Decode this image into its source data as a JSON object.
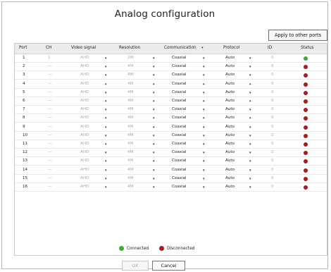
{
  "window": {
    "title": "Analog configuration",
    "apply_button": "Apply to other ports"
  },
  "table": {
    "headers": [
      "Port",
      "CH",
      "Video signal",
      "Resolution",
      "Communication",
      "Protocol",
      "ID",
      "Status"
    ],
    "rows": [
      {
        "port": "1",
        "ch": "1",
        "video": "AHD",
        "resolution": "2M",
        "communication": "Coaxial",
        "protocol": "Auto",
        "id": "0",
        "status": "connected"
      },
      {
        "port": "2",
        "ch": "—",
        "video": "AHD",
        "resolution": "4M",
        "communication": "Coaxial",
        "protocol": "Auto",
        "id": "0",
        "status": "disconnected"
      },
      {
        "port": "3",
        "ch": "—",
        "video": "AHD",
        "resolution": "4M",
        "communication": "Coaxial",
        "protocol": "Auto",
        "id": "0",
        "status": "disconnected"
      },
      {
        "port": "4",
        "ch": "—",
        "video": "AHD",
        "resolution": "4M",
        "communication": "Coaxial",
        "protocol": "Auto",
        "id": "0",
        "status": "disconnected"
      },
      {
        "port": "5",
        "ch": "—",
        "video": "AHD",
        "resolution": "4M",
        "communication": "Coaxial",
        "protocol": "Auto",
        "id": "0",
        "status": "disconnected"
      },
      {
        "port": "6",
        "ch": "—",
        "video": "AHD",
        "resolution": "4M",
        "communication": "Coaxial",
        "protocol": "Auto",
        "id": "0",
        "status": "disconnected"
      },
      {
        "port": "7",
        "ch": "—",
        "video": "AHD",
        "resolution": "4M",
        "communication": "Coaxial",
        "protocol": "Auto",
        "id": "0",
        "status": "disconnected"
      },
      {
        "port": "8",
        "ch": "—",
        "video": "AHD",
        "resolution": "4M",
        "communication": "Coaxial",
        "protocol": "Auto",
        "id": "0",
        "status": "disconnected"
      },
      {
        "port": "9",
        "ch": "—",
        "video": "AHD",
        "resolution": "4M",
        "communication": "Coaxial",
        "protocol": "Auto",
        "id": "0",
        "status": "disconnected"
      },
      {
        "port": "10",
        "ch": "—",
        "video": "AHD",
        "resolution": "4M",
        "communication": "Coaxial",
        "protocol": "Auto",
        "id": "0",
        "status": "disconnected"
      },
      {
        "port": "11",
        "ch": "—",
        "video": "AHD",
        "resolution": "4M",
        "communication": "Coaxial",
        "protocol": "Auto",
        "id": "0",
        "status": "disconnected"
      },
      {
        "port": "12",
        "ch": "—",
        "video": "AHD",
        "resolution": "4M",
        "communication": "Coaxial",
        "protocol": "Auto",
        "id": "0",
        "status": "disconnected"
      },
      {
        "port": "13",
        "ch": "—",
        "video": "AHD",
        "resolution": "4M",
        "communication": "Coaxial",
        "protocol": "Auto",
        "id": "0",
        "status": "disconnected"
      },
      {
        "port": "14",
        "ch": "—",
        "video": "AHD",
        "resolution": "4M",
        "communication": "Coaxial",
        "protocol": "Auto",
        "id": "0",
        "status": "disconnected"
      },
      {
        "port": "15",
        "ch": "—",
        "video": "AHD",
        "resolution": "4M",
        "communication": "Coaxial",
        "protocol": "Auto",
        "id": "0",
        "status": "disconnected"
      },
      {
        "port": "16",
        "ch": "—",
        "video": "AHD",
        "resolution": "4M",
        "communication": "Coaxial",
        "protocol": "Auto",
        "id": "0",
        "status": "disconnected"
      }
    ]
  },
  "legend": {
    "connected": "Connected",
    "disconnected": "Disconnected"
  },
  "buttons": {
    "ok": "OK",
    "cancel": "Cancel"
  },
  "colors": {
    "connected": "#3fa83a",
    "disconnected": "#a81c1c"
  },
  "icons": {
    "dropdown": "chevron-down-icon",
    "status": "status-dot-icon"
  }
}
